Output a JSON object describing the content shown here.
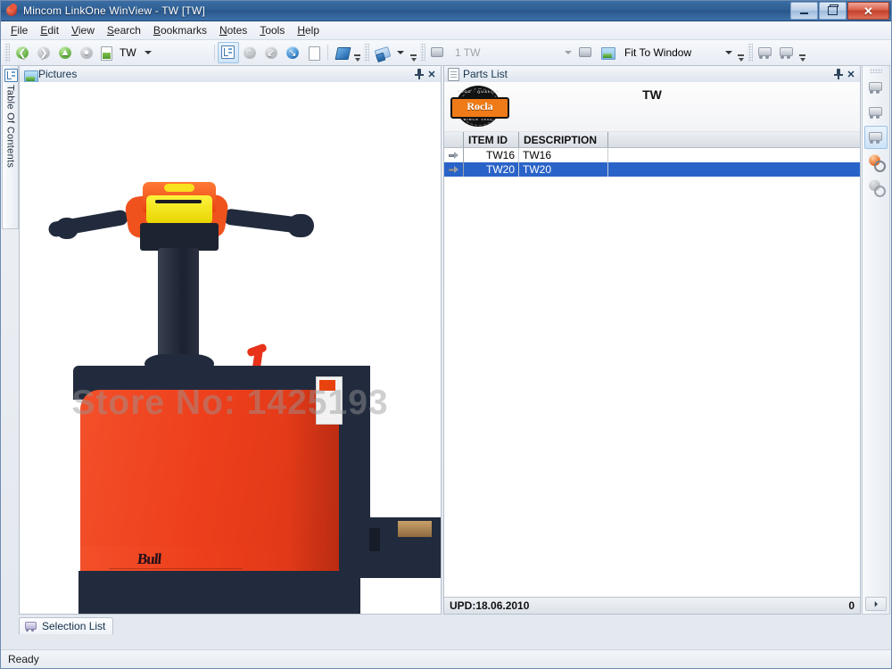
{
  "window": {
    "title": "Mincom LinkOne WinView - TW [TW]",
    "app_icon": "linkone-app-icon",
    "minimize_label": "Minimize",
    "restore_label": "Restore",
    "close_label": "✕"
  },
  "menubar": {
    "items": [
      {
        "label": "File",
        "accel": "F"
      },
      {
        "label": "Edit",
        "accel": "E"
      },
      {
        "label": "View",
        "accel": "V"
      },
      {
        "label": "Search",
        "accel": "S"
      },
      {
        "label": "Bookmarks",
        "accel": "B"
      },
      {
        "label": "Notes",
        "accel": "N"
      },
      {
        "label": "Tools",
        "accel": "T"
      },
      {
        "label": "Help",
        "accel": "H"
      }
    ]
  },
  "toolbar": {
    "nav": [
      {
        "name": "back-icon",
        "state": "enabled"
      },
      {
        "name": "forward-icon",
        "state": "disabled"
      },
      {
        "name": "up-icon",
        "state": "enabled"
      },
      {
        "name": "home-icon",
        "state": "disabled"
      }
    ],
    "book_combo": {
      "value": "TW",
      "icon": "book-page-icon"
    },
    "actions": [
      {
        "name": "table-of-contents-icon",
        "selected": true
      },
      {
        "name": "go-up-level-icon",
        "selected": false
      },
      {
        "name": "go-previous-icon",
        "selected": false
      },
      {
        "name": "go-next-icon",
        "selected": false
      },
      {
        "name": "page-note-icon",
        "selected": false
      },
      {
        "name": "bookmark-icon",
        "selected": false
      }
    ],
    "eraser_button": {
      "name": "highlight-eraser-icon"
    },
    "page_combo": {
      "value": "1 TW",
      "disabled": true,
      "icon": "page-navigate-icon"
    },
    "zoom_combo": {
      "value": "Fit To Window",
      "icon": "zoom-image-icon"
    },
    "right_buttons": [
      {
        "name": "parts-link-icon"
      },
      {
        "name": "parts-link-alt-icon"
      }
    ]
  },
  "left_dock": {
    "tab_label": "Table Of Contents",
    "tab_icon": "table-of-contents-icon"
  },
  "pictures_panel": {
    "title": "Pictures",
    "icon": "picture-icon",
    "pin_label": "Auto Hide",
    "close_label": "✕",
    "watermark": "Store No: 1425193",
    "image": {
      "subject": "Rocla Bull electric pallet truck",
      "body_color": "#ee3f1c",
      "chassis_color": "#222b3d",
      "control_head_color": "#f5e400",
      "lever_color": "#e8321a"
    }
  },
  "bottom_tabs": {
    "items": [
      {
        "label": "Selection List",
        "icon": "selection-list-icon",
        "active": true
      }
    ]
  },
  "parts_panel": {
    "title": "Parts List",
    "icon": "document-icon",
    "pin_label": "Auto Hide",
    "close_label": "✕",
    "banner": {
      "logo_text": "Rocla",
      "logo_top_text": "GOOD · QUALITY",
      "logo_bottom_text": "SINCE 1942",
      "title": "TW"
    },
    "table": {
      "columns": [
        "",
        "ITEM ID",
        "DESCRIPTION",
        ""
      ],
      "rows": [
        {
          "marker": "row-arrow",
          "item_id": "TW16",
          "description": "TW16",
          "extra": "",
          "selected": false
        },
        {
          "marker": "row-arrow",
          "item_id": "TW20",
          "description": "TW20",
          "extra": "",
          "selected": true
        }
      ]
    },
    "status": {
      "left": "UPD:18.06.2010",
      "right": "0"
    }
  },
  "right_toolbar": {
    "buttons": [
      {
        "name": "add-to-selection-list-icon",
        "selected": false
      },
      {
        "name": "remove-from-selection-list-icon",
        "selected": false
      },
      {
        "name": "view-selection-list-icon",
        "selected": true
      },
      {
        "name": "part-lookup-icon",
        "selected": false
      },
      {
        "name": "part-detail-icon",
        "selected": false
      }
    ],
    "expand_label": "⏵"
  },
  "statusbar": {
    "text": "Ready"
  },
  "colors": {
    "titlebar": "#2f5f94",
    "selection": "#2a63c8",
    "brand_orange": "#ee7b17",
    "truck_red": "#ee3f1c",
    "close_red": "#c2412c"
  }
}
